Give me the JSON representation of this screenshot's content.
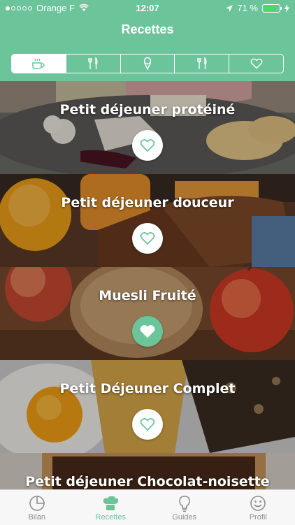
{
  "status": {
    "carrier": "Orange F",
    "time": "12:07",
    "battery": "71 %"
  },
  "nav": {
    "title": "Recettes"
  },
  "filters": [
    {
      "icon": "coffee-cup-icon",
      "active": true
    },
    {
      "icon": "fork-knife-icon",
      "active": false
    },
    {
      "icon": "ice-cream-icon",
      "active": false
    },
    {
      "icon": "fork-knife-icon",
      "active": false
    },
    {
      "icon": "heart-icon",
      "active": false
    }
  ],
  "recipes": [
    {
      "title": "Petit déjeuner protéiné",
      "favorite": false
    },
    {
      "title": "Petit déjeuner douceur",
      "favorite": false
    },
    {
      "title": "Muesli Fruité",
      "favorite": true
    },
    {
      "title": "Petit Déjeuner Complet",
      "favorite": false
    },
    {
      "title": "Petit déjeuner Chocolat-noisette",
      "favorite": false
    }
  ],
  "tabs": [
    {
      "label": "Bilan",
      "icon": "pie-chart-icon",
      "active": false
    },
    {
      "label": "Recettes",
      "icon": "chef-hat-icon",
      "active": true
    },
    {
      "label": "Guides",
      "icon": "lightbulb-icon",
      "active": false
    },
    {
      "label": "Profil",
      "icon": "smiley-icon",
      "active": false
    }
  ],
  "colors": {
    "accent": "#6cc49b",
    "inactive": "#8e8e93",
    "battery": "#4cd964"
  }
}
